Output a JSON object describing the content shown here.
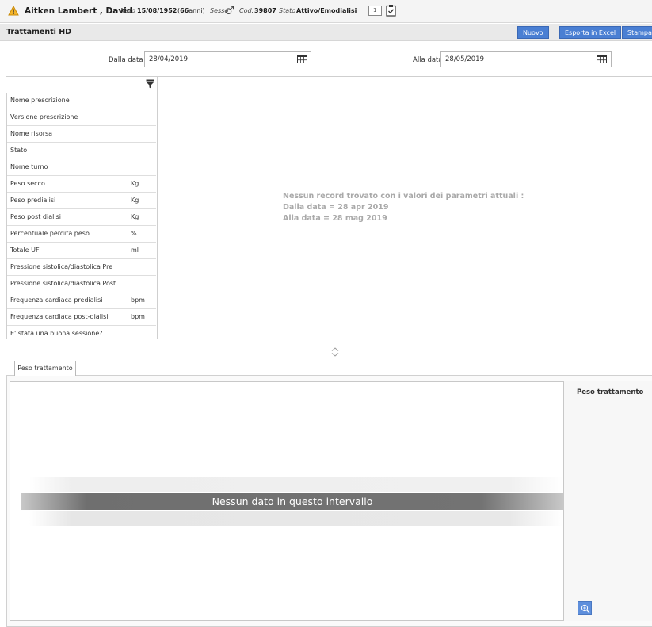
{
  "patient": {
    "name": "Aitken Lambert , David",
    "birth_label": "Nato",
    "birth_date": "15/08/1952",
    "age_open": "(",
    "age_value": "66",
    "age_close": "anni)",
    "sex_label": "Sesso",
    "code_label": "Cod.",
    "code_value": "39807",
    "status_label": "Stato",
    "status_value": "Attivo/Emodialisi",
    "card_count": "1"
  },
  "title_bar": {
    "title": "Trattamenti HD",
    "buttons": [
      "Nuovo",
      "Esporta in Excel",
      "Stampa"
    ]
  },
  "filters": {
    "from_label": "Dalla data",
    "from_value": "28/04/2019",
    "to_label": "Alla data",
    "to_value": "28/05/2019"
  },
  "grid": {
    "rows": [
      {
        "label": "Nome prescrizione",
        "unit": ""
      },
      {
        "label": "Versione prescrizione",
        "unit": ""
      },
      {
        "label": "Nome risorsa",
        "unit": ""
      },
      {
        "label": "Stato",
        "unit": ""
      },
      {
        "label": "Nome turno",
        "unit": ""
      },
      {
        "label": "Peso secco",
        "unit": "Kg"
      },
      {
        "label": "Peso predialisi",
        "unit": "Kg"
      },
      {
        "label": "Peso post dialisi",
        "unit": "Kg"
      },
      {
        "label": "Percentuale perdita peso",
        "unit": "%"
      },
      {
        "label": "Totale UF",
        "unit": "ml"
      },
      {
        "label": "Pressione sistolica/diastolica Pre",
        "unit": ""
      },
      {
        "label": "Pressione sistolica/diastolica Post",
        "unit": ""
      },
      {
        "label": "Frequenza cardiaca predialisi",
        "unit": "bpm"
      },
      {
        "label": "Frequenza cardiaca post-dialisi",
        "unit": "bpm"
      },
      {
        "label": "E' stata una buona sessione?",
        "unit": ""
      }
    ],
    "no_record": {
      "line1": "Nessun record trovato con i valori dei parametri attuali :",
      "line2": "Dalla data = 28 apr 2019",
      "line3": "Alla data = 28 mag 2019"
    }
  },
  "lower_panel": {
    "tab_label": "Peso trattamento",
    "no_data": "Nessun dato in questo intervallo",
    "legend_title": "Peso trattamento"
  },
  "icons": {
    "warning": "warning-icon",
    "sex": "male-icon",
    "card": "card-icon",
    "clipboard": "clipboard-check-icon",
    "calendar": "calendar-icon",
    "filter": "filter-icon",
    "splitter": "splitter-handle-icon",
    "zoom": "zoom-in-icon"
  },
  "colors": {
    "accent_button": "#4a7fd3",
    "warning": "#e8a21a",
    "no_data_band": "#737373",
    "no_record_text": "#a9a9a9"
  }
}
